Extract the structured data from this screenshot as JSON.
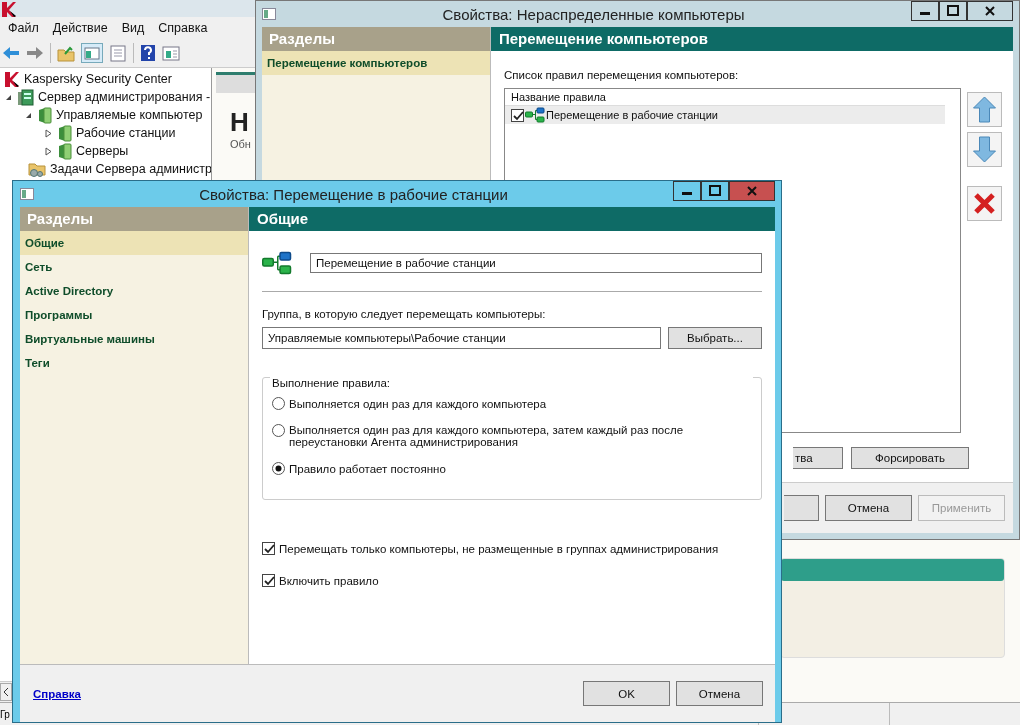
{
  "console": {
    "menu": [
      "Файл",
      "Действие",
      "Вид",
      "Справка"
    ],
    "tree": [
      {
        "label": "Kaspersky Security Center",
        "kind": "logo",
        "children": [
          {
            "label": "Сервер администрирования -",
            "kind": "server",
            "expanded": true,
            "children": [
              {
                "label": "Управляемые компьютер",
                "kind": "group",
                "expanded": true,
                "children": [
                  {
                    "label": "Рабочие станции",
                    "kind": "group",
                    "expanded": false
                  },
                  {
                    "label": "Серверы",
                    "kind": "group",
                    "expanded": false
                  }
                ]
              },
              {
                "label": "Задачи Сервера администр",
                "kind": "tasks"
              }
            ]
          }
        ]
      }
    ],
    "pane_heading": "Н",
    "pane_subtitle": "Обн",
    "status_bar": "Гр"
  },
  "back_dialog": {
    "title": "Свойства: Нераспределенные компьютеры",
    "sections_header": "Разделы",
    "sections": [
      {
        "label": "Перемещение компьютеров",
        "selected": true
      }
    ],
    "heading": "Перемещение компьютеров",
    "list_label": "Список правил перемещения компьютеров:",
    "column": "Название правила",
    "rules": [
      {
        "label": "Перемещение в рабочие станции",
        "checked": true,
        "selected": true
      }
    ],
    "list_buttons": [
      {
        "label": "тва",
        "kind": "clipped"
      },
      {
        "label": "Форсировать",
        "kind": "normal"
      }
    ],
    "footer_buttons": [
      {
        "kind": "clipped",
        "disabled": false
      },
      {
        "label": "Отмена",
        "kind": "normal",
        "disabled": false
      },
      {
        "label": "Применить",
        "kind": "normal",
        "disabled": true
      }
    ]
  },
  "front_dialog": {
    "title": "Свойства: Перемещение в рабочие станции",
    "sections_header": "Разделы",
    "sections": [
      {
        "label": "Общие",
        "selected": true
      },
      {
        "label": "Сеть",
        "selected": false
      },
      {
        "label": "Active Directory",
        "selected": false
      },
      {
        "label": "Программы",
        "selected": false
      },
      {
        "label": "Виртуальные машины",
        "selected": false
      },
      {
        "label": "Теги",
        "selected": false
      }
    ],
    "heading": "Общие",
    "rule_name": "Перемещение в рабочие станции",
    "group_label": "Группа, в которую следует перемещать компьютеры:",
    "group_path": "Управляемые компьютеры\\Рабочие станции",
    "choose_button": "Выбрать...",
    "execution_legend": "Выполнение правила:",
    "radios": [
      {
        "label": "Выполняется один раз для каждого компьютера",
        "selected": false
      },
      {
        "label": "Выполняется один раз для каждого компьютера, затем каждый раз после переустановки Агента администрирования",
        "selected": false
      },
      {
        "label": "Правило работает постоянно",
        "selected": true
      }
    ],
    "checkboxes": [
      {
        "label": "Перемещать только компьютеры, не размещенные в группах администрирования",
        "checked": true
      },
      {
        "label": "Включить правило",
        "checked": true
      }
    ],
    "help_link": "Справка",
    "buttons": [
      "OK",
      "Отмена"
    ]
  }
}
